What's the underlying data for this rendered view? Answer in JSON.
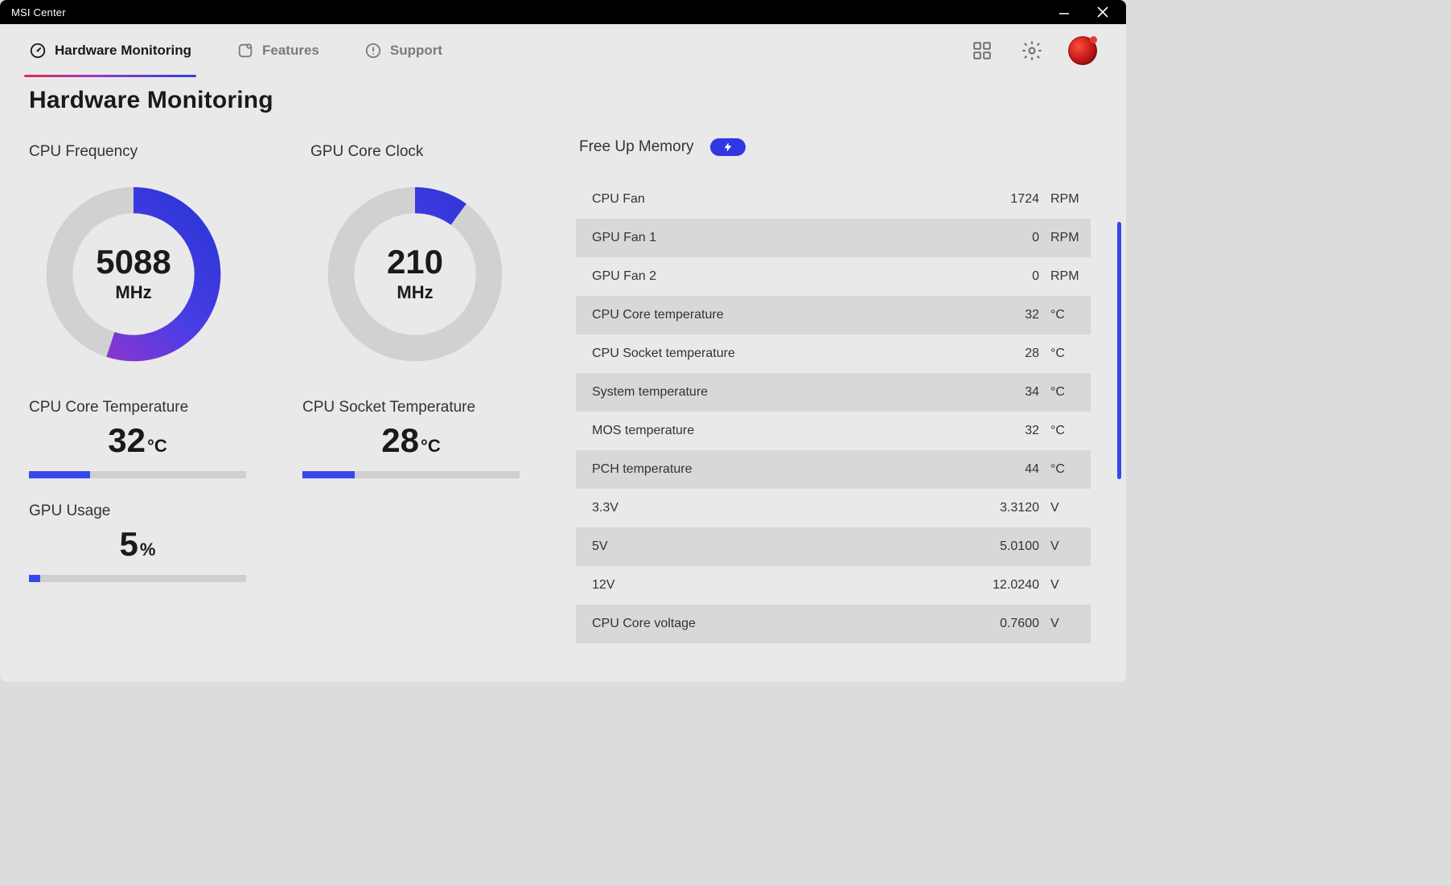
{
  "window": {
    "title": "MSI Center"
  },
  "tabs": {
    "hardware": "Hardware Monitoring",
    "features": "Features",
    "support": "Support"
  },
  "page_title": "Hardware Monitoring",
  "gauges": {
    "cpu_freq": {
      "label": "CPU Frequency",
      "value": "5088",
      "unit": "MHz",
      "fraction": 0.55
    },
    "gpu_clock": {
      "label": "GPU Core Clock",
      "value": "210",
      "unit": "MHz",
      "fraction": 0.1
    }
  },
  "temps": {
    "cpu_core": {
      "label": "CPU Core Temperature",
      "value": "32",
      "unit": "°C",
      "bar": 0.28
    },
    "cpu_socket": {
      "label": "CPU Socket Temperature",
      "value": "28",
      "unit": "°C",
      "bar": 0.24
    }
  },
  "gpu_usage": {
    "label": "GPU Usage",
    "value": "5",
    "unit": "%",
    "bar": 0.05
  },
  "free_up": {
    "label": "Free Up Memory"
  },
  "sensors": [
    {
      "name": "CPU Fan",
      "value": "1724",
      "unit": "RPM"
    },
    {
      "name": "GPU Fan 1",
      "value": "0",
      "unit": "RPM"
    },
    {
      "name": "GPU Fan 2",
      "value": "0",
      "unit": "RPM"
    },
    {
      "name": "CPU Core temperature",
      "value": "32",
      "unit": "°C"
    },
    {
      "name": "CPU Socket temperature",
      "value": "28",
      "unit": "°C"
    },
    {
      "name": "System temperature",
      "value": "34",
      "unit": "°C"
    },
    {
      "name": "MOS temperature",
      "value": "32",
      "unit": "°C"
    },
    {
      "name": "PCH temperature",
      "value": "44",
      "unit": "°C"
    },
    {
      "name": "3.3V",
      "value": "3.3120",
      "unit": "V"
    },
    {
      "name": "5V",
      "value": "5.0100",
      "unit": "V"
    },
    {
      "name": "12V",
      "value": "12.0240",
      "unit": "V"
    },
    {
      "name": "CPU Core voltage",
      "value": "0.7600",
      "unit": "V"
    }
  ]
}
